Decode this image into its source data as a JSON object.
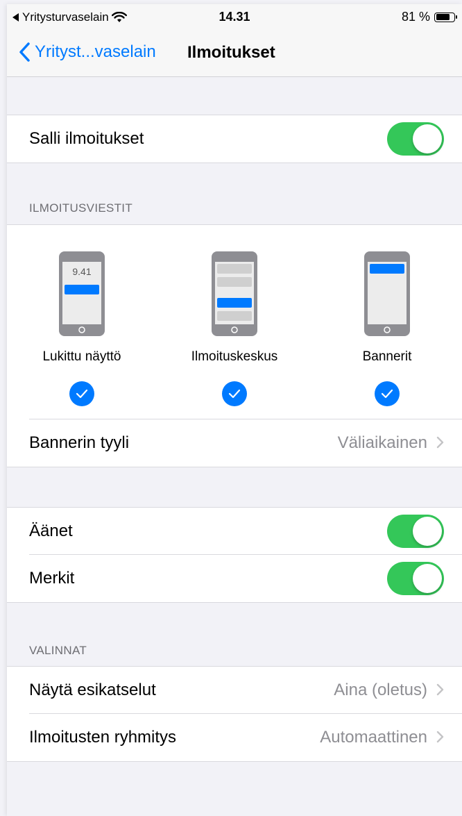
{
  "status": {
    "back_app": "Yritysturvaselain",
    "time": "14.31",
    "battery_percent": "81 %",
    "battery_level": 0.81
  },
  "nav": {
    "back_label": "Yrityst...vaselain",
    "title": "Ilmoitukset"
  },
  "allow": {
    "label": "Salli ilmoitukset",
    "on": true
  },
  "alerts": {
    "header": "ILMOITUSVIESTIT",
    "options": [
      {
        "label": "Lukittu näyttö",
        "mock_time": "9.41",
        "checked": true
      },
      {
        "label": "Ilmoituskeskus",
        "checked": true
      },
      {
        "label": "Bannerit",
        "checked": true
      }
    ],
    "banner_style": {
      "label": "Bannerin tyyli",
      "value": "Väliaikainen"
    }
  },
  "sounds": {
    "label": "Äänet",
    "on": true
  },
  "badges": {
    "label": "Merkit",
    "on": true
  },
  "options": {
    "header": "VALINNAT",
    "previews": {
      "label": "Näytä esikatselut",
      "value": "Aina (oletus)"
    },
    "grouping": {
      "label": "Ilmoitusten ryhmitys",
      "value": "Automaattinen"
    }
  },
  "colors": {
    "accent": "#007aff",
    "toggle_on": "#34c759",
    "secondary_text": "#8e8e93",
    "background": "#f2f2f7"
  }
}
